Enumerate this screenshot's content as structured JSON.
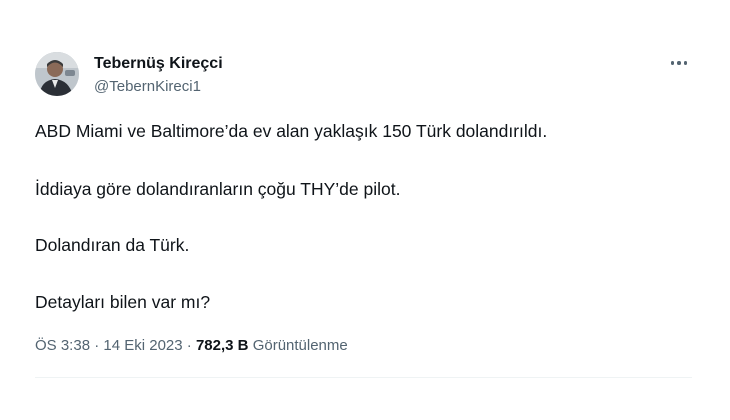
{
  "author": {
    "name": "Tebernüş Kireçci",
    "handle": "@TebernKireci1"
  },
  "tweet": {
    "lines": [
      "ABD Miami ve Baltimore’da ev alan yaklaşık 150 Türk dolandırıldı.",
      "İddiaya göre dolandıranların çoğu THY’de pilot.",
      "Dolandıran da Türk.",
      "Detayları bilen var mı?"
    ],
    "time": "ÖS 3:38",
    "separator": "·",
    "date": "14 Eki 2023",
    "views_count": "782,3 B",
    "views_label": "Görüntülenme"
  },
  "icons": {
    "more": "more-options-icon",
    "avatar": "profile-photo"
  },
  "colors": {
    "text": "#0f1419",
    "secondary": "#536471",
    "divider": "#eff3f4",
    "background": "#ffffff"
  }
}
